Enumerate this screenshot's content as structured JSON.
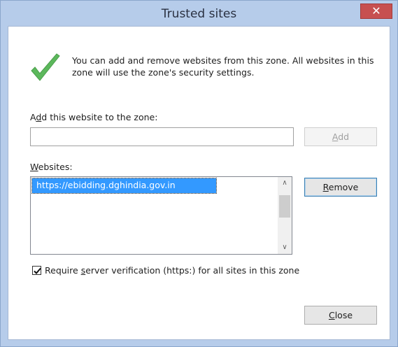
{
  "window": {
    "title": "Trusted sites",
    "close_glyph": "✕"
  },
  "intro_text": "You can add and remove websites from this zone. All websites in this zone will use the zone's security settings.",
  "add_section": {
    "label_pre": "A",
    "label_ul": "d",
    "label_post": "d this website to the zone:",
    "input_value": "",
    "add_button_pre": "",
    "add_button_ul": "A",
    "add_button_post": "dd"
  },
  "websites_section": {
    "label_ul": "W",
    "label_post": "ebsites:",
    "items": [
      "https://ebidding.dghindia.gov.in"
    ],
    "scroll_up_glyph": "∧",
    "scroll_down_glyph": "∨",
    "remove_button_ul": "R",
    "remove_button_post": "emove"
  },
  "verification": {
    "checked": true,
    "label_pre": "Require ",
    "label_ul": "s",
    "label_post": "erver verification (https:) for all sites in this zone"
  },
  "close_button": {
    "ul": "C",
    "post": "lose"
  },
  "colors": {
    "selection": "#3399ff",
    "check_icon": "#5cb85c",
    "title_close": "#c75050",
    "frame": "#b6ccea"
  },
  "icons": {
    "trusted": "check-mark-icon",
    "close": "close-icon"
  }
}
